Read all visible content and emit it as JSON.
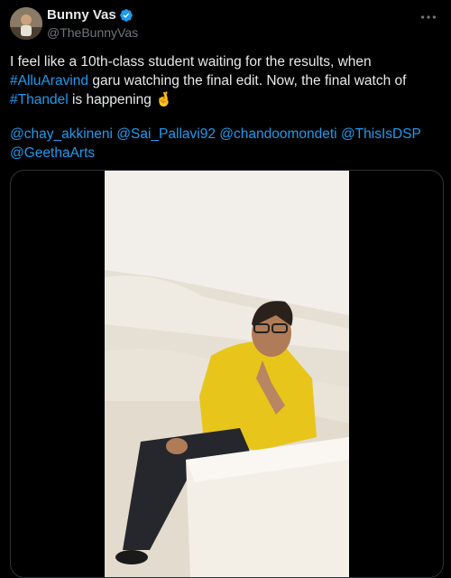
{
  "author": {
    "display_name": "Bunny Vas",
    "handle": "@TheBunnyVas",
    "verified": true,
    "avatar_icon": "profile-avatar"
  },
  "tweet": {
    "text_1": "I feel like a 10th-class student waiting for the results, when ",
    "hashtag_1": "#AlluAravind",
    "text_2": " garu watching the final edit. Now, the final watch of ",
    "hashtag_2": "#Thandel",
    "text_3": " is happening ",
    "emoji": "🤞",
    "mentions": [
      "@chay_akkineni",
      "@Sai_Pallavi92",
      "@chandoomondeti",
      "@ThisIsDSP",
      "@GeethaArts"
    ]
  },
  "media": {
    "type": "video"
  },
  "colors": {
    "background": "#000000",
    "text": "#e7e9ea",
    "secondary": "#71767b",
    "link": "#1d9bf0",
    "shirt": "#e8c51a",
    "sofa": "#ede7dc"
  },
  "icons": {
    "more": "more-horizontal-icon",
    "verified": "verified-badge-icon"
  }
}
